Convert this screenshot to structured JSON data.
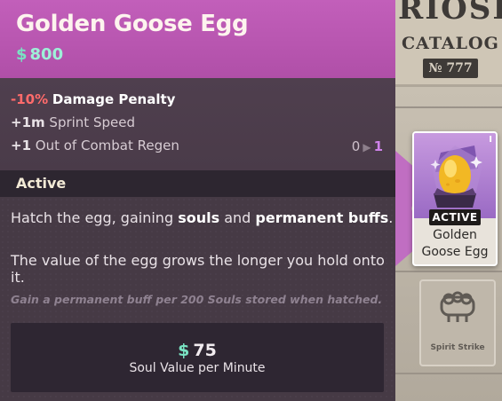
{
  "item": {
    "title": "Golden Goose Egg",
    "currency_symbol": "$",
    "price": "800"
  },
  "stats": [
    {
      "value": "-10%",
      "label": "Damage Penalty"
    },
    {
      "value": "+1m",
      "label": "Sprint Speed"
    },
    {
      "value": "+1",
      "label": "Out of Combat Regen",
      "progress_from": "0",
      "progress_to": "1"
    }
  ],
  "active_section": {
    "label": "Active",
    "line1_pre": "Hatch the egg, gaining ",
    "line1_b1": "souls",
    "line1_mid": " and ",
    "line1_b2": "permanent buffs",
    "line1_post": ".",
    "line2": "The value of the egg grows the longer you hold onto it.",
    "note": "Gain a permanent buff per 200 Souls stored when hatched."
  },
  "soul_box": {
    "symbol": "$",
    "value": "75",
    "caption": "Soul Value per Minute"
  },
  "catalog": {
    "partial_title": "RIOSI",
    "title": "CATALOG",
    "number": "№ 777"
  },
  "item_card": {
    "tier": "I",
    "badge": "ACTIVE",
    "name_line1": "Golden",
    "name_line2": "Goose Egg"
  },
  "spirit_card": {
    "name": "Spirit Strike"
  },
  "colors": {
    "header": "#b04fa8",
    "penalty": "#ff6b6b",
    "currency": "#79e3c3",
    "panel": "#463a45"
  },
  "icons": [
    "souls-currency-icon",
    "golden-egg-icon",
    "spirit-strike-icon",
    "arrow-right-icon"
  ]
}
